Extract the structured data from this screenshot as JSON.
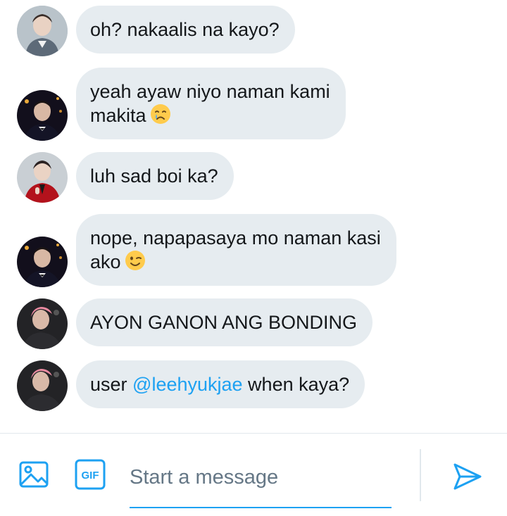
{
  "messages": [
    {
      "text": "oh? nakaalis na kayo?"
    },
    {
      "line1": "yeah ayaw niyo naman kami",
      "line2": "makita",
      "emoji": "crying-face-emoji"
    },
    {
      "text": "luh sad boi ka?"
    },
    {
      "line1": "nope, napapasaya mo naman kasi",
      "line2": "ako",
      "emoji": "winking-face-emoji"
    },
    {
      "text": "AYON GANON ANG BONDING"
    },
    {
      "prefix": "user ",
      "mention": "@leehyukjae",
      "suffix": " when kaya?"
    }
  ],
  "composer": {
    "placeholder": "Start a message",
    "gif_label": "GIF",
    "media_icon": "image-icon",
    "send_icon": "send-icon"
  },
  "colors": {
    "accent": "#1da1f2",
    "bubble": "#e6ecf0",
    "text": "#14171a",
    "placeholder": "#657786"
  }
}
